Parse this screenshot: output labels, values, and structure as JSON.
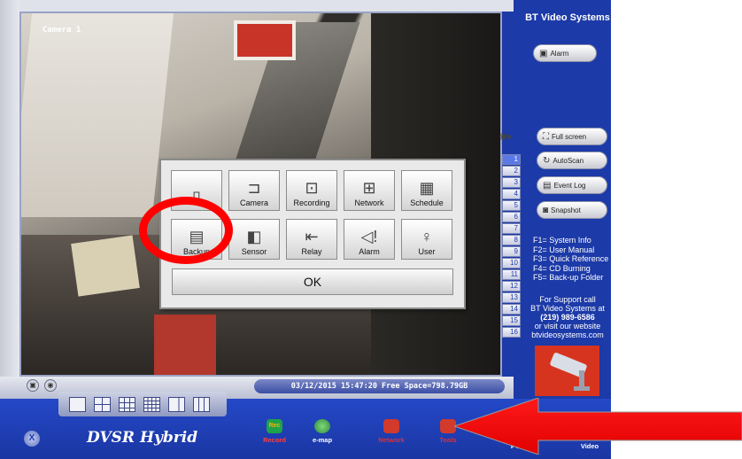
{
  "camera": {
    "label": "Camera 1"
  },
  "dialog": {
    "tools": [
      {
        "label": "",
        "icon": "pc-icon"
      },
      {
        "label": "Camera",
        "icon": "camera-icon"
      },
      {
        "label": "Recording",
        "icon": "film-camera-icon"
      },
      {
        "label": "Network",
        "icon": "network-icon"
      },
      {
        "label": "Schedule",
        "icon": "calendar-icon"
      },
      {
        "label": "Backup",
        "icon": "backup-icon"
      },
      {
        "label": "Sensor",
        "icon": "sensor-icon"
      },
      {
        "label": "Relay",
        "icon": "relay-icon"
      },
      {
        "label": "Alarm",
        "icon": "alarm-icon"
      },
      {
        "label": "User",
        "icon": "user-icon"
      }
    ],
    "ok_label": "OK"
  },
  "channels": [
    "1",
    "2",
    "3",
    "4",
    "5",
    "6",
    "7",
    "8",
    "9",
    "10",
    "11",
    "12",
    "13",
    "14",
    "15",
    "16"
  ],
  "right_panel": {
    "brand": "BT Video Systems",
    "alarm_label": "Alarm",
    "fullscreen_label": "Full screen",
    "autoscan_label": "AutoScan",
    "eventlog_label": "Event Log",
    "snapshot_label": "Snapshot",
    "fkeys": [
      "F1= System Info",
      "F2= User Manual",
      "F3= Quick Reference",
      "F4= CD Burning",
      "F5= Back-up Folder"
    ],
    "support_lines": [
      "For Support call",
      "BT Video Systems at"
    ],
    "phone": "(219) 989-6586",
    "website_lines": [
      "or visit our website",
      "btvideosystems.com"
    ]
  },
  "status": {
    "text": "03/12/2015 15:47:20 Free Space=798.79GB"
  },
  "bottom_bar": {
    "app_name": "DVSR Hybrid",
    "record_label": "Record",
    "record_badge": "Rec",
    "emap_label": "e-map",
    "network_label": "Network",
    "tools_label": "Tools",
    "ptz_label": "PTZ",
    "video_label": "Video"
  },
  "colors": {
    "panel_blue": "#1c3aa8",
    "highlight_red": "#ff0000",
    "active_tab": "#e03030"
  }
}
